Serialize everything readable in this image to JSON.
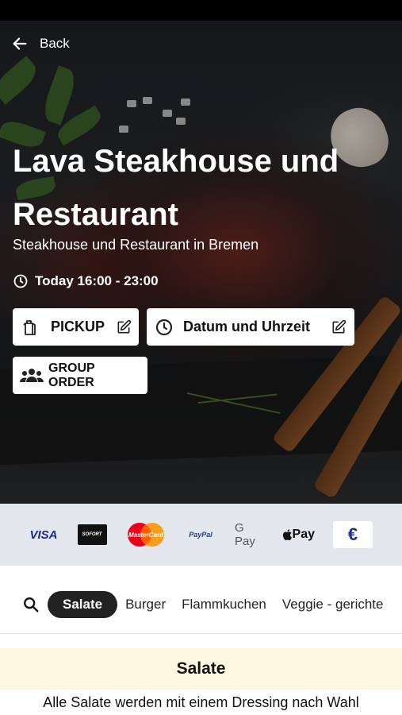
{
  "header": {
    "back_label": "Back"
  },
  "restaurant": {
    "name": "Lava Steakhouse und Restaurant",
    "subtitle": "Steakhouse und Restaurant in Bremen",
    "hours": "Today 16:00 - 23:00"
  },
  "actions": {
    "pickup_label": "PICKUP",
    "datetime_label": "Datum und Uhrzeit",
    "group_order_label": "GROUP ORDER"
  },
  "payments": {
    "visa": "VISA",
    "sofort": "SOFORT",
    "mastercard": "MasterCard",
    "paypal": "PayPal",
    "gpay": "G Pay",
    "apple_pay": "Pay",
    "euro": "€"
  },
  "categories": {
    "items": [
      "Salate",
      "Burger",
      "Flammkuchen",
      "Veggie - gerichte"
    ],
    "active": "Salate"
  },
  "section": {
    "title": "Salate",
    "description": "Alle Salate werden mit einem Dressing nach Wahl"
  },
  "colors": {
    "active_chip": "#222222",
    "payments_band": "#e3e8ef",
    "section_band": "#fdf6e1"
  }
}
